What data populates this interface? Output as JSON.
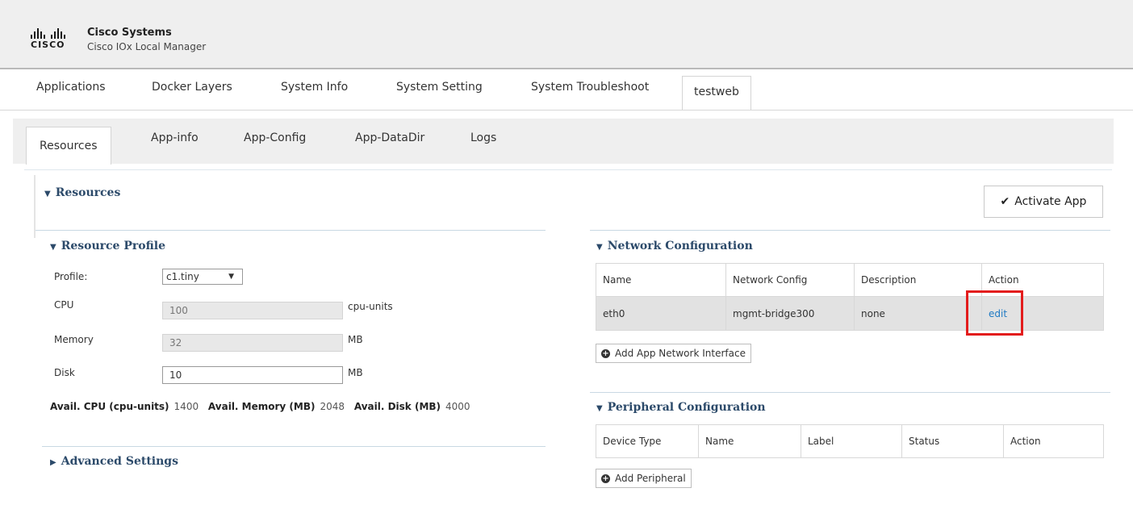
{
  "header": {
    "company": "Cisco Systems",
    "product": "Cisco IOx Local Manager",
    "logo_word": "CISCO"
  },
  "top_tabs": [
    "Applications",
    "Docker Layers",
    "System Info",
    "System Setting",
    "System Troubleshoot",
    "testweb"
  ],
  "sub_tabs": [
    "Resources",
    "App-info",
    "App-Config",
    "App-DataDir",
    "Logs"
  ],
  "resources": {
    "title": "Resources",
    "activate_label": "Activate App"
  },
  "profile": {
    "title": "Resource Profile",
    "profile_label": "Profile:",
    "profile_value": "c1.tiny",
    "cpu_label": "CPU",
    "cpu_value": "100",
    "cpu_unit": "cpu-units",
    "memory_label": "Memory",
    "memory_value": "32",
    "memory_unit": "MB",
    "disk_label": "Disk",
    "disk_value": "10",
    "disk_unit": "MB",
    "avail_cpu_label": "Avail. CPU (cpu-units)",
    "avail_cpu": "1400",
    "avail_mem_label": "Avail. Memory (MB)",
    "avail_mem": "2048",
    "avail_disk_label": "Avail. Disk (MB)",
    "avail_disk": "4000"
  },
  "advanced": {
    "title": "Advanced Settings"
  },
  "network": {
    "title": "Network Configuration",
    "headers": [
      "Name",
      "Network Config",
      "Description",
      "Action"
    ],
    "row": {
      "name": "eth0",
      "config": "mgmt-bridge300",
      "description": "none",
      "action": "edit"
    },
    "add_label": "Add App Network Interface"
  },
  "peripheral": {
    "title": "Peripheral Configuration",
    "headers": [
      "Device Type",
      "Name",
      "Label",
      "Status",
      "Action"
    ],
    "add_label": "Add Peripheral"
  },
  "colors": {
    "highlight": "#e31c1c",
    "link": "#1f7ac3",
    "section_title": "#2c4a6a"
  }
}
